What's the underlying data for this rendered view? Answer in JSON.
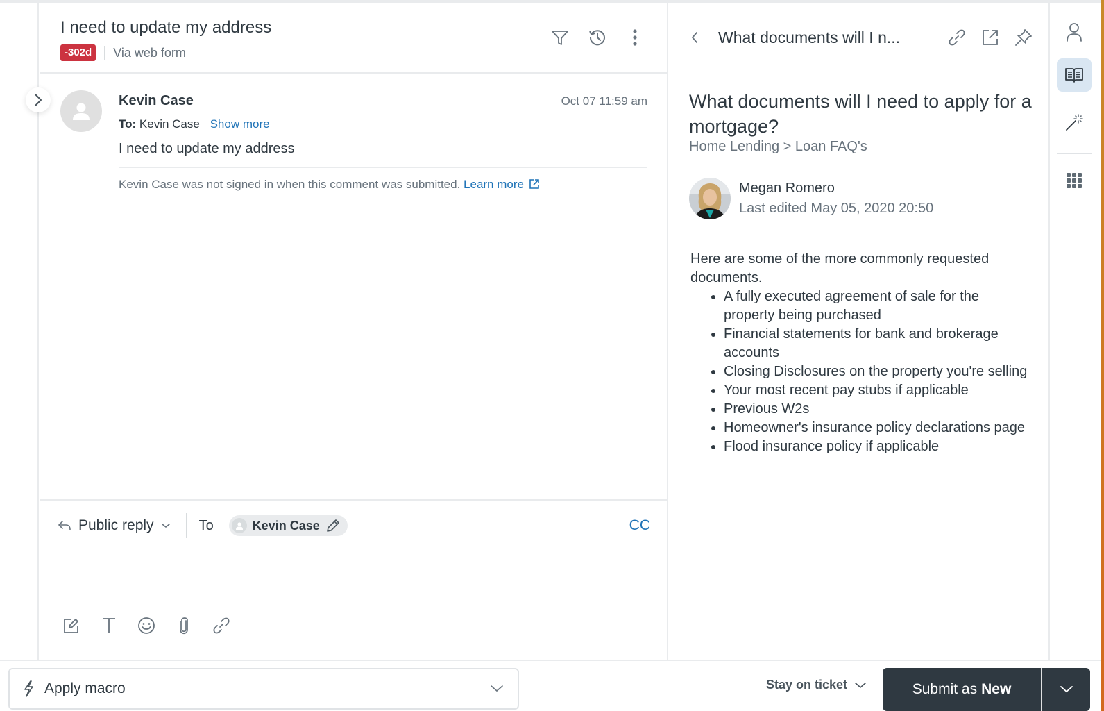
{
  "ticket": {
    "title": "I need to update my address",
    "sla_badge": "-302d",
    "channel": "Via web form",
    "colors": {
      "sla": "#cc3340",
      "link": "#1f73b7",
      "primary_button": "#2f3941"
    }
  },
  "header_actions": [
    {
      "icon": "filter-icon",
      "label": "Filter"
    },
    {
      "icon": "history-icon",
      "label": "History"
    },
    {
      "icon": "more-vertical-icon",
      "label": "More"
    }
  ],
  "message": {
    "author": "Kevin Case",
    "timestamp": "Oct 07 11:59 am",
    "to_label": "To:",
    "to_value": "Kevin Case",
    "show_more": "Show more",
    "body": "I need to update my address",
    "note": "Kevin Case was not signed in when this comment was submitted.",
    "learn_more": "Learn more"
  },
  "reply": {
    "type_label": "Public reply",
    "to_label": "To",
    "recipient": "Kevin Case",
    "cc_label": "CC",
    "toolbar": [
      {
        "icon": "compose-icon"
      },
      {
        "icon": "text-format-icon"
      },
      {
        "icon": "emoji-icon"
      },
      {
        "icon": "attachment-icon"
      },
      {
        "icon": "link-icon"
      }
    ]
  },
  "knowledge": {
    "header_title": "What documents will I n...",
    "title": "What documents will I need to apply for a mortgage?",
    "breadcrumb": "Home Lending > Loan FAQ's",
    "author": "Megan Romero",
    "last_edited": "Last edited May 05, 2020 20:50",
    "intro": "Here are some of the more commonly requested documents.",
    "items": [
      "A fully executed agreement of sale for the property being purchased",
      "Financial statements for bank and brokerage accounts",
      "Closing Disclosures on the property you're selling",
      "Your most recent pay stubs if applicable",
      "Previous W2s",
      "Homeowner's insurance policy declarations page",
      "Flood insurance policy if applicable"
    ]
  },
  "rail": [
    {
      "icon": "user-icon",
      "active": false
    },
    {
      "icon": "knowledge-book-icon",
      "active": true
    },
    {
      "icon": "magic-wand-icon",
      "active": false
    },
    {
      "icon": "apps-grid-icon",
      "active": false
    }
  ],
  "footer": {
    "macro_label": "Apply macro",
    "stay_label": "Stay on ticket",
    "submit_prefix": "Submit as",
    "submit_status": "New"
  }
}
